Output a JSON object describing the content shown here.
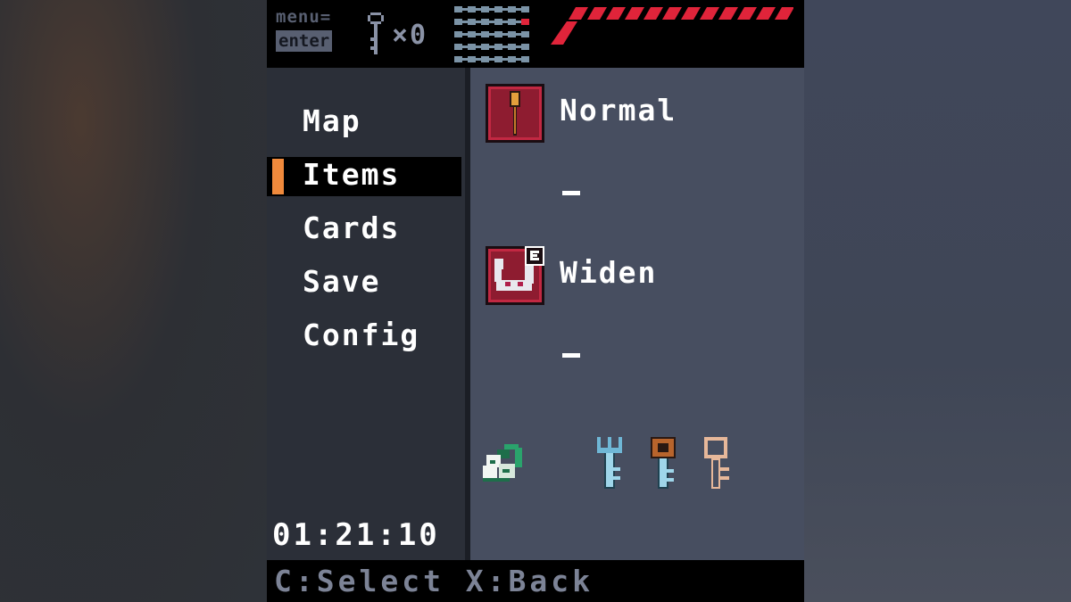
{
  "hud": {
    "menu_hint_label": "menu=",
    "menu_hint_key": "enter",
    "key_count": "×0",
    "health_segments": 12
  },
  "menu": {
    "items": [
      {
        "label": "Map"
      },
      {
        "label": "Items"
      },
      {
        "label": "Cards"
      },
      {
        "label": "Save"
      },
      {
        "label": "Config"
      }
    ],
    "selected": "Items"
  },
  "timer": "01:21:10",
  "items_panel": {
    "slots": [
      {
        "name": "Normal",
        "icon": "broom-icon",
        "empty_marker": "_"
      },
      {
        "name": "Widen",
        "icon": "horseshoe-magnet-icon",
        "empty_marker": "_"
      }
    ],
    "collectibles": [
      {
        "icon": "leaf-charm-icon"
      },
      {
        "icon": "fork-key-icon"
      },
      {
        "icon": "copper-key-icon"
      },
      {
        "icon": "pale-key-icon"
      }
    ]
  },
  "footer": {
    "controls": "C:Select X:Back"
  },
  "colors": {
    "accent": "#f08a3c",
    "health": "#e0243a",
    "panel": "#474e60",
    "sidebar": "#2b2f38"
  }
}
